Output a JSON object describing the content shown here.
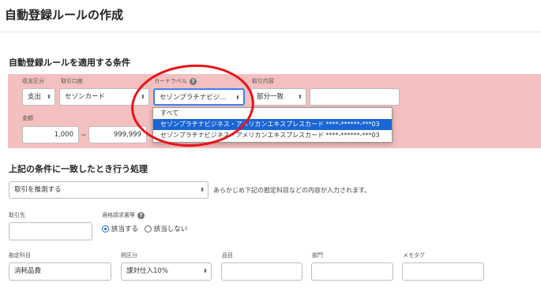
{
  "page": {
    "title": "自動登録ルールの作成"
  },
  "conditions": {
    "section_title": "自動登録ルールを適用する条件",
    "income_type": {
      "label": "収支区分",
      "value": "支出"
    },
    "account": {
      "label": "取引口座",
      "value": "セゾンカード"
    },
    "card_label": {
      "label": "カードラベル",
      "value": "セゾンプラチナビジ...",
      "options": [
        "すべて",
        "セゾンプラチナビジネス・アメリカンエキスプレスカード ****-******-***03",
        "セゾンプラチナビジネス・アメリカンエキスプレスカード ****-******-***03"
      ],
      "selected_index": 1
    },
    "description": {
      "label": "取引内容",
      "match_value": "部分一致",
      "text_value": ""
    },
    "amount": {
      "label": "金額",
      "min": "1,000",
      "separator": "~",
      "max": "999,999"
    }
  },
  "processing": {
    "section_title": "上記の条件に一致したとき行う処理",
    "action": {
      "value": "取引を推測する"
    },
    "helper_text": "あらかじめ下記の勘定科目などの内容が入力されます。",
    "partner": {
      "label": "取引先",
      "value": ""
    },
    "invoice": {
      "label": "適格請求書等",
      "options": [
        "該当する",
        "該当しない"
      ],
      "selected": "該当する"
    },
    "account_item": {
      "label": "勘定科目",
      "value": "消耗品費"
    },
    "tax": {
      "label": "税区分",
      "value": "課対仕入10%"
    },
    "item": {
      "label": "品目",
      "value": ""
    },
    "department": {
      "label": "部門",
      "value": ""
    },
    "memo_tag": {
      "label": "メモタグ",
      "value": ""
    }
  }
}
